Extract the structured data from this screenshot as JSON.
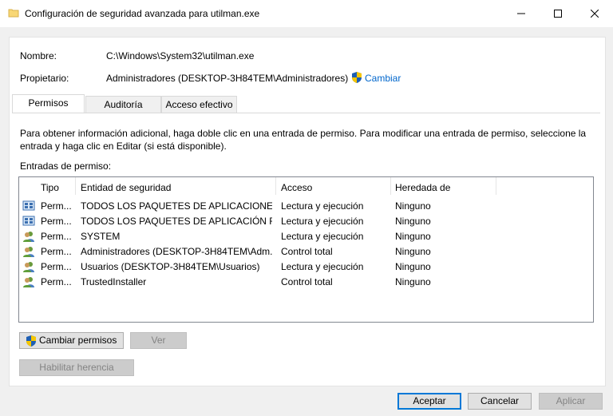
{
  "window": {
    "title": "Configuración de seguridad avanzada para utilman.exe"
  },
  "info": {
    "name_label": "Nombre:",
    "name_value": "C:\\Windows\\System32\\utilman.exe",
    "owner_label": "Propietario:",
    "owner_value": "Administradores (DESKTOP-3H84TEM\\Administradores)",
    "change_link": "Cambiar"
  },
  "tabs": [
    {
      "label": "Permisos"
    },
    {
      "label": "Auditoría"
    },
    {
      "label": "Acceso efectivo"
    }
  ],
  "description": "Para obtener información adicional, haga doble clic en una entrada de permiso. Para modificar una entrada de permiso, seleccione la entrada y haga clic en Editar (si está disponible).",
  "entries_label": "Entradas de permiso:",
  "table": {
    "headers": [
      "Tipo",
      "Entidad de seguridad",
      "Acceso",
      "Heredada de"
    ],
    "rows": [
      {
        "icon": "package-icon",
        "type": "Perm...",
        "principal": "TODOS LOS PAQUETES DE APLICACIONES",
        "access": "Lectura y ejecución",
        "inherited": "Ninguno"
      },
      {
        "icon": "package-icon",
        "type": "Perm...",
        "principal": "TODOS LOS PAQUETES DE APLICACIÓN RE...",
        "access": "Lectura y ejecución",
        "inherited": "Ninguno"
      },
      {
        "icon": "users-icon",
        "type": "Perm...",
        "principal": "SYSTEM",
        "access": "Lectura y ejecución",
        "inherited": "Ninguno"
      },
      {
        "icon": "users-icon",
        "type": "Perm...",
        "principal": "Administradores (DESKTOP-3H84TEM\\Adm...",
        "access": "Control total",
        "inherited": "Ninguno"
      },
      {
        "icon": "users-icon",
        "type": "Perm...",
        "principal": "Usuarios (DESKTOP-3H84TEM\\Usuarios)",
        "access": "Lectura y ejecución",
        "inherited": "Ninguno"
      },
      {
        "icon": "users-icon",
        "type": "Perm...",
        "principal": "TrustedInstaller",
        "access": "Control total",
        "inherited": "Ninguno"
      }
    ]
  },
  "buttons": {
    "change_permissions": "Cambiar permisos",
    "view": "Ver",
    "enable_inheritance": "Habilitar herencia",
    "accept": "Aceptar",
    "cancel": "Cancelar",
    "apply": "Aplicar"
  }
}
